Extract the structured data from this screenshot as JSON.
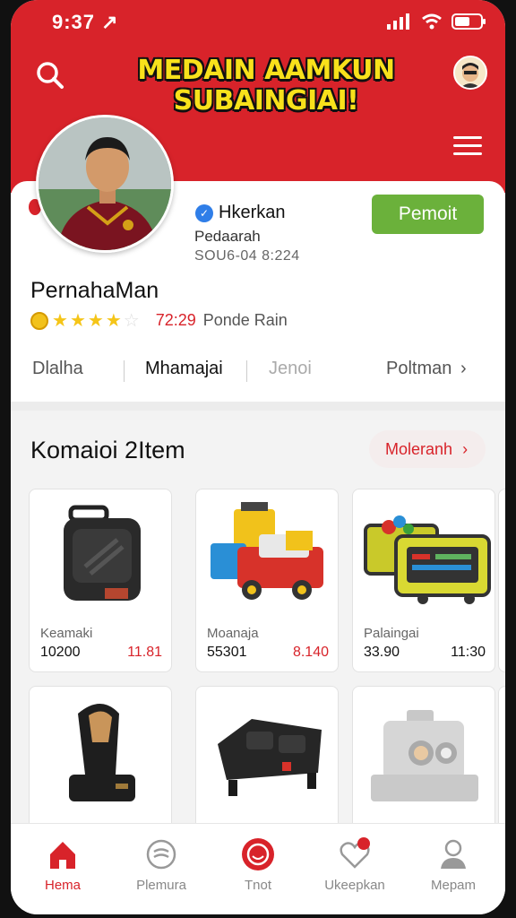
{
  "status_bar": {
    "time": "9:37",
    "arrow": "↗"
  },
  "header": {
    "banner_line1": "MEDAIN AAMKUN",
    "banner_line2": "SUBAINGIAI!",
    "colors": {
      "brand": "#d8232a",
      "banner_text": "#f8e11b"
    }
  },
  "profile": {
    "verified_label": "Hkerkan",
    "subtitle": "Pedaarah",
    "date": "SOU6-04 8:224",
    "follow_label": "Pemoit",
    "store_name": "PernahaMan",
    "rating_stars": 4,
    "rating_value": "72:29",
    "rating_label": "Ponde Rain"
  },
  "tabs": [
    {
      "label": "Dlalha",
      "active": false
    },
    {
      "label": "Mhamajai",
      "active": true
    },
    {
      "label": "Jenoi",
      "active": false
    },
    {
      "label": "Poltman",
      "active": false
    }
  ],
  "section": {
    "title": "Komaioi 2Item",
    "more_label": "Moleranh"
  },
  "products": [
    {
      "name": "Keamaki",
      "price": "10200",
      "price2": "11.81",
      "price2_color": "red",
      "icon": "speaker-icon"
    },
    {
      "name": "Moanaja",
      "price": "55301",
      "price2": "8.140",
      "price2_color": "red",
      "icon": "toy-truck-icon"
    },
    {
      "name": "Palaingai",
      "price": "33.90",
      "price2": "11:30",
      "price2_color": "dark",
      "icon": "game-box-icon"
    },
    {
      "name": "",
      "price": "",
      "price2": "",
      "icon": "handheld-device-icon"
    },
    {
      "name": "",
      "price": "",
      "price2": "",
      "icon": "black-case-icon"
    },
    {
      "name": "",
      "price": "",
      "price2": "",
      "icon": "projector-icon"
    }
  ],
  "bottom_nav": [
    {
      "label": "Hema",
      "icon": "home-icon",
      "active": true
    },
    {
      "label": "Plemura",
      "icon": "chat-icon",
      "active": false
    },
    {
      "label": "Tnot",
      "icon": "circle-button-icon",
      "active": false
    },
    {
      "label": "Ukeepkan",
      "icon": "heart-notification-icon",
      "active": false
    },
    {
      "label": "Mepam",
      "icon": "person-icon",
      "active": false
    }
  ]
}
